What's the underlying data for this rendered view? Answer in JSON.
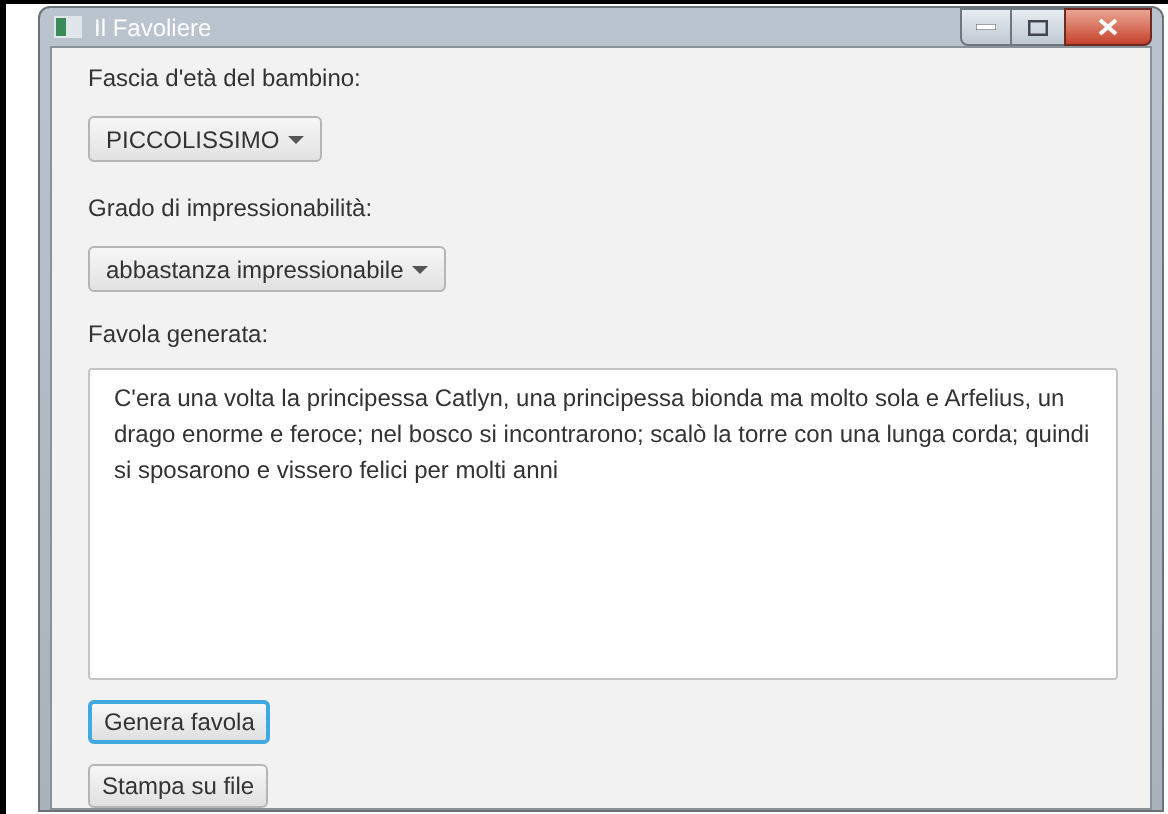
{
  "window": {
    "title": "Il Favoliere"
  },
  "age": {
    "label": "Fascia d'età del bambino:",
    "value": "PICCOLISSIMO"
  },
  "sensitivity": {
    "label": "Grado di impressionabilità:",
    "value": "abbastanza impressionabile"
  },
  "story": {
    "label": "Favola generata:",
    "value": "C'era una volta la principessa Catlyn, una principessa bionda ma molto sola e Arfelius, un drago enorme e feroce; nel bosco si incontrarono; scalò la torre con una lunga corda; quindi si sposarono e vissero felici per molti anni"
  },
  "buttons": [
    {
      "label": "Genera favola",
      "focused": true
    },
    {
      "label": "Stampa su file",
      "focused": false
    }
  ]
}
